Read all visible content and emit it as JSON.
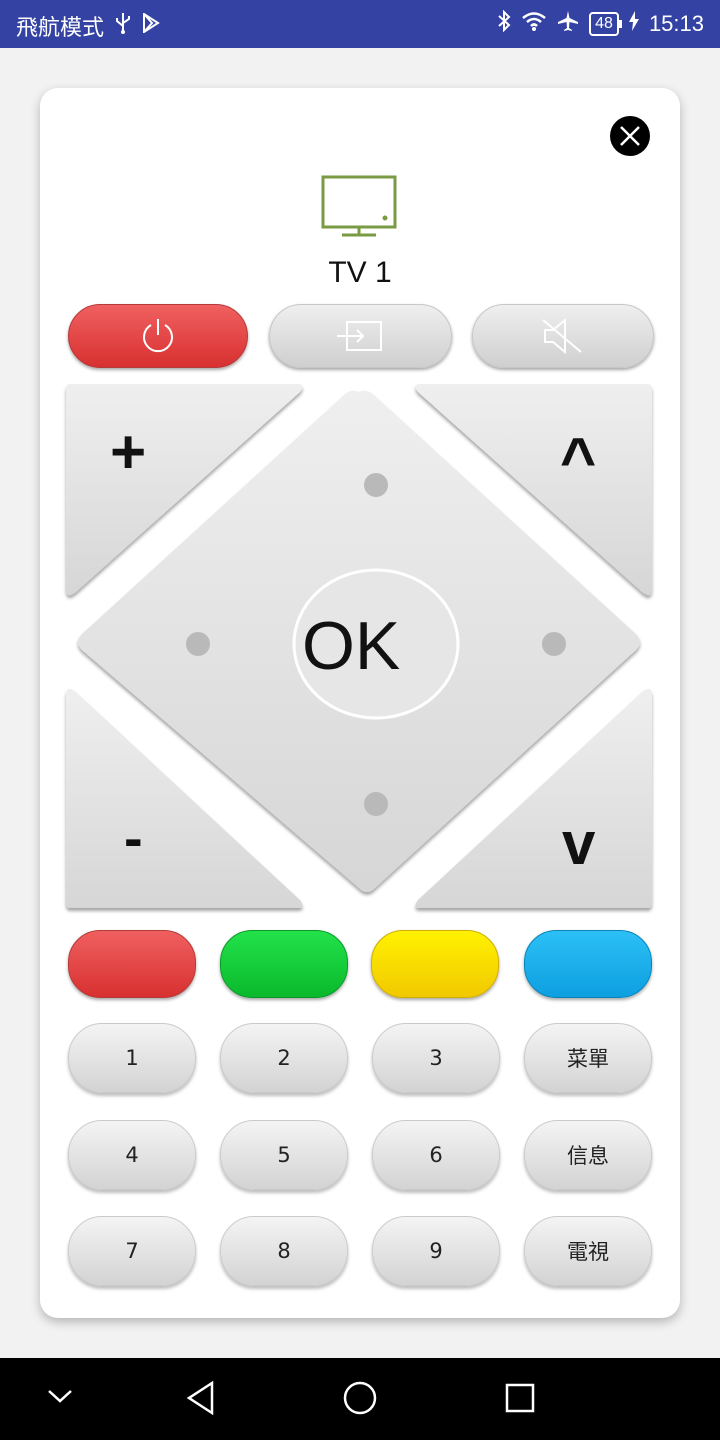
{
  "status_bar": {
    "left_text": "飛航模式",
    "battery": "48",
    "time": "15:13"
  },
  "device": {
    "name": "TV 1"
  },
  "icons": {
    "close": "close-icon",
    "tv": "tv-icon",
    "power": "power-icon",
    "input": "input-source-icon",
    "mute": "mute-icon"
  },
  "dpad": {
    "ok_label": "OK",
    "vol_up_label": "+",
    "vol_down_label": "-",
    "ch_up_label": "^",
    "ch_down_label": "v"
  },
  "color_keys": [
    "#e84545",
    "#0fcf38",
    "#f9e000",
    "#1cb0ee"
  ],
  "keypad": [
    [
      "1",
      "2",
      "3",
      "菜單"
    ],
    [
      "4",
      "5",
      "6",
      "信息"
    ],
    [
      "7",
      "8",
      "9",
      "電視"
    ]
  ],
  "colors": {
    "status_bar": "#3342a3",
    "tv_icon": "#7a9a44",
    "power_button": "#e04545"
  }
}
